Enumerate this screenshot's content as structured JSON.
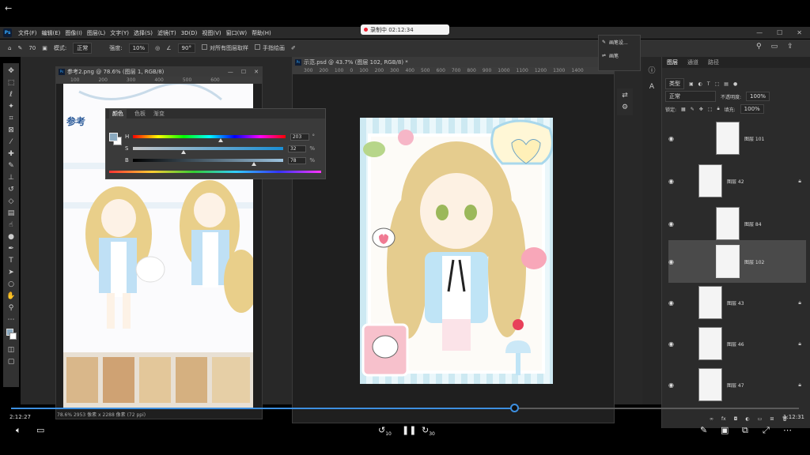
{
  "video": {
    "back_icon": "back-arrow-icon",
    "recording_text": "录制中 02:12:34",
    "current_time": "2:12:27",
    "total_time": "1:12:31",
    "progress": 0.64,
    "skip_back": "10",
    "skip_forward": "30"
  },
  "menu": {
    "items": [
      "文件(F)",
      "编辑(E)",
      "图像(I)",
      "图层(L)",
      "文字(Y)",
      "选择(S)",
      "滤镜(T)",
      "3D(D)",
      "视图(V)",
      "窗口(W)",
      "帮助(H)"
    ]
  },
  "options": {
    "mode_label": "模式:",
    "mode_value": "正常",
    "opacity_label": "强度:",
    "opacity_value": "10%",
    "angle_value": "90°",
    "sample_all": "对所有图层取样",
    "finger_paint": "手指绘画",
    "brush_size": "70"
  },
  "ref_doc": {
    "title": "参考2.png @ 78.6% (图层 1, RGB/8)",
    "ruler": [
      "100",
      "200",
      "300",
      "400",
      "500",
      "600"
    ],
    "heading": "参考",
    "status": "78.6%    2953 像素 x 2288 像素 (72 ppi)"
  },
  "color_panel": {
    "tabs": [
      "颜色",
      "色板",
      "渐变"
    ],
    "h_label": "H",
    "h_value": "203",
    "h_unit": "°",
    "s_label": "S",
    "s_value": "32",
    "s_unit": "%",
    "b_label": "B",
    "b_value": "78",
    "b_unit": "%",
    "foreground_color": "#8aa9bf"
  },
  "main_doc": {
    "title": "示范.psd @ 43.7% (图层 102, RGB/8) *",
    "ruler": [
      "300",
      "200",
      "100",
      "0",
      "100",
      "200",
      "300",
      "400",
      "500",
      "600",
      "700",
      "800",
      "900",
      "1000",
      "1100",
      "1200",
      "1300",
      "1400"
    ]
  },
  "brush_panel": {
    "items": [
      "画笔设...",
      "画笔"
    ]
  },
  "layers": {
    "tabs": [
      "图层",
      "通道",
      "路径"
    ],
    "filter_label": "类型",
    "blend_mode": "正常",
    "opacity_label": "不透明度:",
    "opacity_value": "100%",
    "lock_label": "锁定:",
    "fill_label": "填充:",
    "fill_value": "100%",
    "items": [
      {
        "name": "图层 101",
        "locked": false,
        "selected": false
      },
      {
        "name": "图层 42",
        "locked": true,
        "selected": false
      },
      {
        "name": "图层 84",
        "locked": false,
        "selected": false
      },
      {
        "name": "图层 102",
        "locked": false,
        "selected": true
      },
      {
        "name": "图层 43",
        "locked": true,
        "selected": false
      },
      {
        "name": "图层 46",
        "locked": true,
        "selected": false
      },
      {
        "name": "图层 47",
        "locked": true,
        "selected": false
      }
    ]
  }
}
